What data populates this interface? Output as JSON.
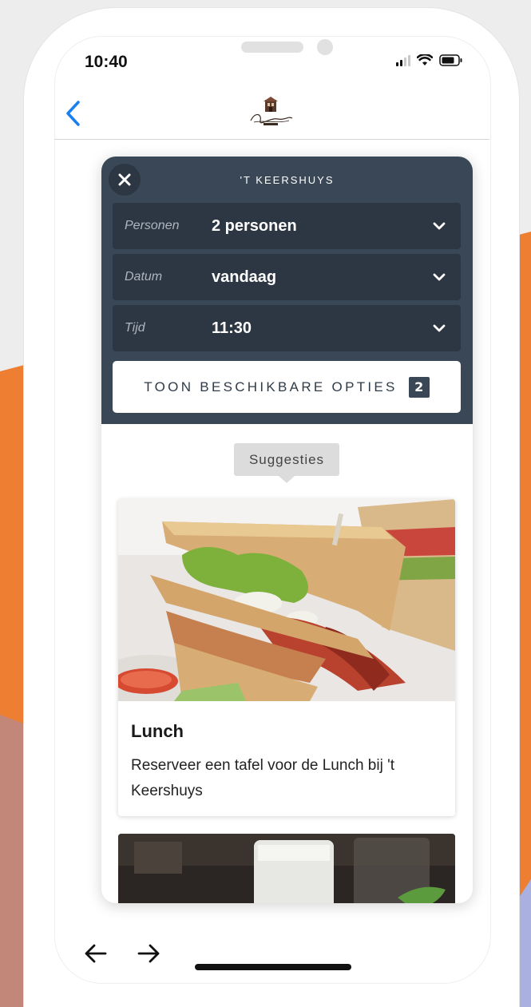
{
  "status_bar": {
    "time": "10:40"
  },
  "header": {
    "logo_text": "'t Keershuys"
  },
  "widget": {
    "title": "'T KEERSHUYS",
    "fields": [
      {
        "label": "Personen",
        "value": "2 personen"
      },
      {
        "label": "Datum",
        "value": "vandaag"
      },
      {
        "label": "Tijd",
        "value": "11:30"
      }
    ],
    "cta": {
      "label": "TOON BESCHIKBARE OPTIES",
      "count": "2"
    },
    "suggestions_label": "Suggesties",
    "cards": [
      {
        "title": "Lunch",
        "description": "Reserveer een tafel voor de Lunch bij 't Keershuys"
      }
    ]
  },
  "colors": {
    "accent_blue": "#1a7ff0",
    "header_bg": "#3a4756",
    "field_bg": "#2c3743",
    "bg_orange": "#ee7e32",
    "bg_brown": "#c38779"
  }
}
